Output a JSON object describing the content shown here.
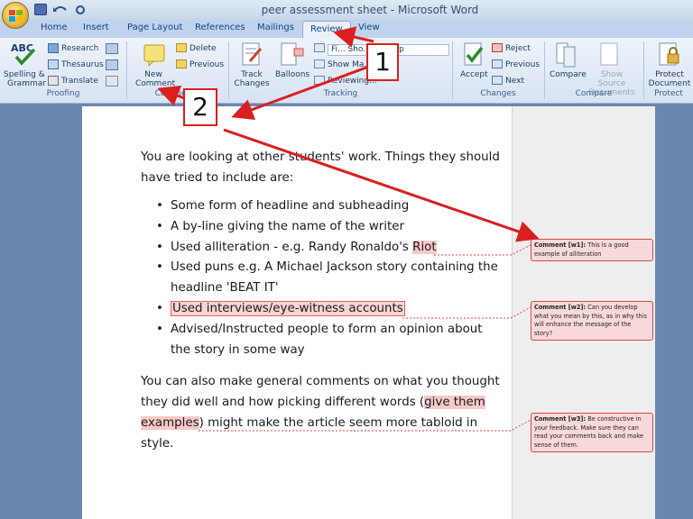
{
  "window": {
    "title": "peer assessment sheet - Microsoft Word"
  },
  "tabs": [
    "Home",
    "Insert",
    "Page Layout",
    "References",
    "Mailings",
    "Review",
    "View"
  ],
  "active_tab": "Review",
  "ribbon": {
    "proofing": {
      "label": "Proofing",
      "spelling": "Spelling &",
      "grammar": "Grammar",
      "research": "Research",
      "thesaurus": "Thesaurus",
      "translate": "Translate"
    },
    "comments": {
      "label": "Comments",
      "new_line1": "New",
      "new_line2": "Comment",
      "delete": "Delete",
      "previous": "Previous"
    },
    "tracking": {
      "label": "Tracking",
      "track_line1": "Track",
      "track_line2": "Changes",
      "balloons": "Balloons",
      "final_show": "Fi... Sho... ...arkup",
      "show_markup": "Show Ma...",
      "reviewing_pane": "Reviewing..."
    },
    "changes": {
      "label": "Changes",
      "accept": "Accept",
      "reject": "Reject",
      "previous": "Previous",
      "next": "Next"
    },
    "compare": {
      "label": "Compare",
      "compare": "Compare",
      "show_source_line1": "Show Source",
      "show_source_line2": "Documents"
    },
    "protect": {
      "label": "Protect",
      "line1": "Protect",
      "line2": "Document"
    }
  },
  "document": {
    "intro_line1": "You are looking at other students' work. Things they should",
    "intro_line2": "have tried to include are:",
    "bullets": [
      "Some form of headline and subheading",
      "A by-line giving the name of the writer",
      "Used alliteration - e.g. Randy Ronaldo's ",
      "Riot",
      "Used puns e.g. A Michael Jackson story containing the",
      "headline 'BEAT IT'",
      "Used interviews/eye-witness accounts",
      "Advised/Instructed people to form an opinion about",
      "the story in some way"
    ],
    "para2_line1a": "You can also make general comments on what you thought",
    "para2_line2a": "they did well and how picking different words (",
    "para2_line2b": "give them",
    "para2_line3a": "examples",
    "para2_line3b": ") might make the article seem more tabloid in",
    "para2_line4": "style."
  },
  "comments": [
    {
      "tag": "Comment [w1]:",
      "text": "This is a good example of alliteration"
    },
    {
      "tag": "Comment [w2]:",
      "text": "Can you develop what you mean by this, as in why this will enhance the message of the story?"
    },
    {
      "tag": "Comment [w3]:",
      "text": "Be constructive in your feedback. Make sure they can read your comments back and make sense of them."
    }
  ],
  "callouts": [
    "1",
    "2"
  ],
  "colors": {
    "accent_red": "#d91f1f",
    "comment_fill": "#f8d9d9",
    "ribbon_blue": "#15428b"
  }
}
